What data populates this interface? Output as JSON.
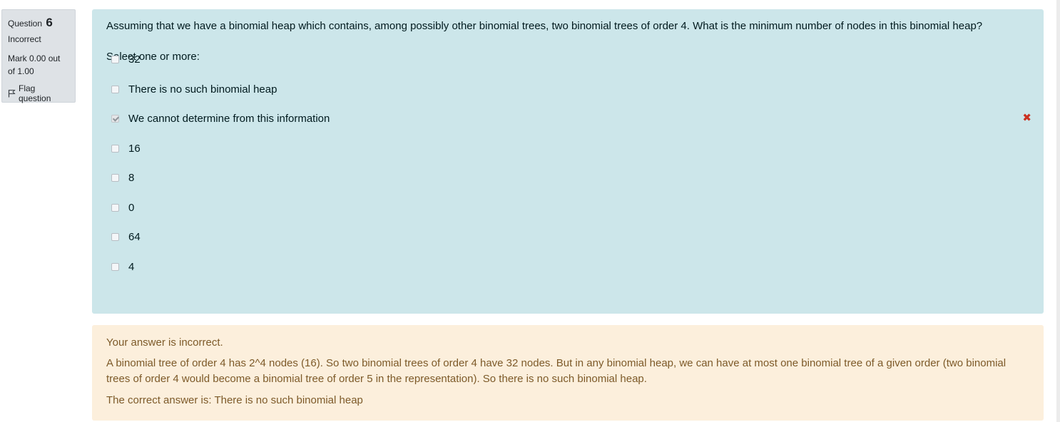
{
  "info": {
    "question_label": "Question",
    "question_number": "6",
    "state": "Incorrect",
    "grade": "Mark 0.00 out of 1.00",
    "flag_label": "Flag question"
  },
  "question": {
    "text": "Assuming that we have a binomial heap which contains, among possibly other binomial trees, two binomial trees of order 4. What is the minimum number of nodes in this binomial heap?",
    "prompt": "Select one or more:",
    "options": [
      {
        "label": "32",
        "checked": false
      },
      {
        "label": "There is no such binomial heap",
        "checked": false
      },
      {
        "label": "We cannot determine from this information",
        "checked": true,
        "incorrect_mark": "✖"
      },
      {
        "label": "16",
        "checked": false
      },
      {
        "label": "8",
        "checked": false
      },
      {
        "label": "0",
        "checked": false
      },
      {
        "label": "64",
        "checked": false
      },
      {
        "label": "4",
        "checked": false
      }
    ]
  },
  "feedback": {
    "status": "Your answer is incorrect.",
    "general": "A binomial tree of order 4 has 2^4 nodes (16). So two binomial trees of order 4 have 32 nodes. But in any binomial heap, we can have at most one binomial tree of a given order (two binomial trees of order 4 would become a binomial tree of order 5 in the representation). So there is no such binomial heap.",
    "right_answer": "The correct answer is: There is no such binomial heap"
  },
  "colors": {
    "formulation_bg": "#cce6ea",
    "outcome_bg": "#fcefdc",
    "info_bg": "#dee2e6",
    "incorrect_red": "#ca3120"
  }
}
